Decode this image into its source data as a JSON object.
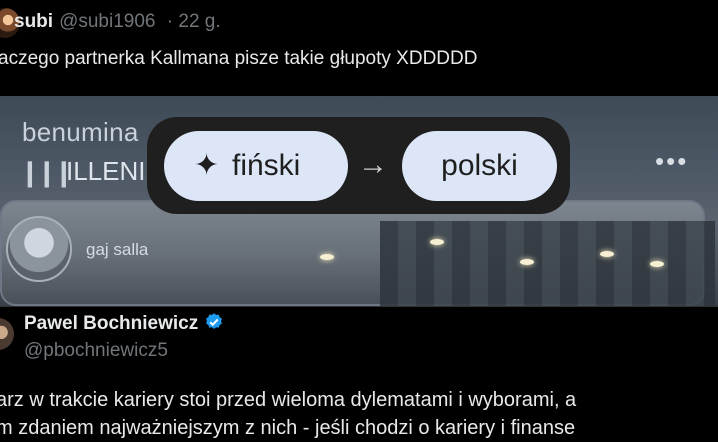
{
  "tweet1": {
    "display_name": "subi",
    "handle": "@subi1906",
    "time": "· 22 g.",
    "text": "aczego partnerka Kallmana pisze takie głupoty XDDDDD"
  },
  "media": {
    "label_top": "benumina",
    "bars": "▎▎▎",
    "label_artist": "ILLENI",
    "dots": "•••",
    "username": "gaj salla",
    "sign": "",
    "translate": {
      "source_lang": "fiński",
      "target_lang": "polski",
      "arrow": "→",
      "sparkle": "✦"
    }
  },
  "tweet2": {
    "display_name": "Pawel Bochniewicz",
    "handle": "@pbochniewicz5",
    "line1": "arz w trakcie kariery stoi przed wieloma dylematami i wyborami, a",
    "line2": "m zdaniem najważniejszym z nich - jeśli chodzi o kariery i finanse"
  },
  "colors": {
    "background": "#000000",
    "text": "#e7e9ea",
    "muted": "#71767b",
    "chip": "#dce6f7",
    "overlay": "#1f1f1f",
    "verified": "#1d9bf0"
  }
}
